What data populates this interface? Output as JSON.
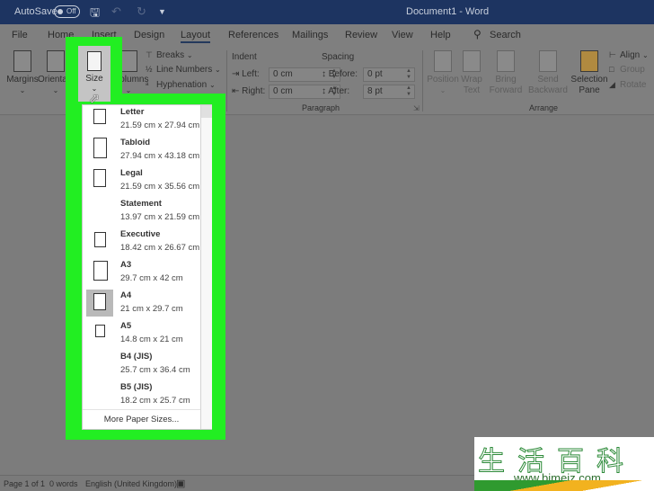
{
  "titlebar": {
    "autosave_label": "AutoSave",
    "autosave_state": "Off",
    "title": "Document1  -  Word",
    "icons": [
      "save-icon",
      "undo-icon",
      "redo-icon",
      "customize-qat-icon"
    ]
  },
  "tabs": [
    {
      "label": "File"
    },
    {
      "label": "Home"
    },
    {
      "label": "Insert"
    },
    {
      "label": "Design"
    },
    {
      "label": "Layout",
      "active": true
    },
    {
      "label": "References"
    },
    {
      "label": "Mailings"
    },
    {
      "label": "Review"
    },
    {
      "label": "View"
    },
    {
      "label": "Help"
    }
  ],
  "search": {
    "label": "Search",
    "icon": "search-icon"
  },
  "ribbon": {
    "page_setup": {
      "margins": "Margins",
      "orientation": "Orientation",
      "size": "Size",
      "columns": "Columns",
      "breaks": "Breaks",
      "line_numbers": "Line Numbers",
      "hyphenation": "Hyphenation"
    },
    "paragraph": {
      "indent_label": "Indent",
      "spacing_label": "Spacing",
      "left_label": "Left:",
      "left_value": "0 cm",
      "right_label": "Right:",
      "right_value": "0 cm",
      "before_label": "Before:",
      "before_value": "0 pt",
      "after_label": "After:",
      "after_value": "8 pt",
      "group_label": "Paragraph"
    },
    "arrange": {
      "position": "Position",
      "wrap_text_1": "Wrap",
      "wrap_text_2": "Text",
      "bring_forward_1": "Bring",
      "bring_forward_2": "Forward",
      "send_backward_1": "Send",
      "send_backward_2": "Backward",
      "selection_pane_1": "Selection",
      "selection_pane_2": "Pane",
      "align": "Align",
      "group": "Group",
      "rotate": "Rotate",
      "group_label": "Arrange"
    }
  },
  "size_menu": {
    "items": [
      {
        "name": "Letter",
        "dims": "21.59 cm x 27.94 cm",
        "icon": "portrait-page-icon"
      },
      {
        "name": "Tabloid",
        "dims": "27.94 cm x 43.18 cm",
        "icon": "portrait-page-icon"
      },
      {
        "name": "Legal",
        "dims": "21.59 cm x 35.56 cm",
        "icon": "portrait-page-icon"
      },
      {
        "name": "Statement",
        "dims": "13.97 cm x 21.59 cm",
        "icon": ""
      },
      {
        "name": "Executive",
        "dims": "18.42 cm x 26.67 cm",
        "icon": "portrait-page-icon"
      },
      {
        "name": "A3",
        "dims": "29.7 cm x 42 cm",
        "icon": "portrait-page-icon"
      },
      {
        "name": "A4",
        "dims": "21 cm x 29.7 cm",
        "icon": "portrait-page-icon",
        "selected": true
      },
      {
        "name": "A5",
        "dims": "14.8 cm x 21 cm",
        "icon": "portrait-page-icon"
      },
      {
        "name": "B4 (JIS)",
        "dims": "25.7 cm x 36.4 cm",
        "icon": ""
      },
      {
        "name": "B5 (JIS)",
        "dims": "18.2 cm x 25.7 cm",
        "icon": ""
      }
    ],
    "more_label": "More Paper Sizes..."
  },
  "statusbar": {
    "page": "Page 1 of 1",
    "words": "0 words",
    "language": "English (United Kingdom)",
    "icon": "accessibility-icon"
  },
  "watermark": {
    "chars": "生活百科",
    "url": "www.bimeiz.com"
  },
  "colors": {
    "highlight": "#22ee22",
    "titlebar": "#1d3461"
  }
}
